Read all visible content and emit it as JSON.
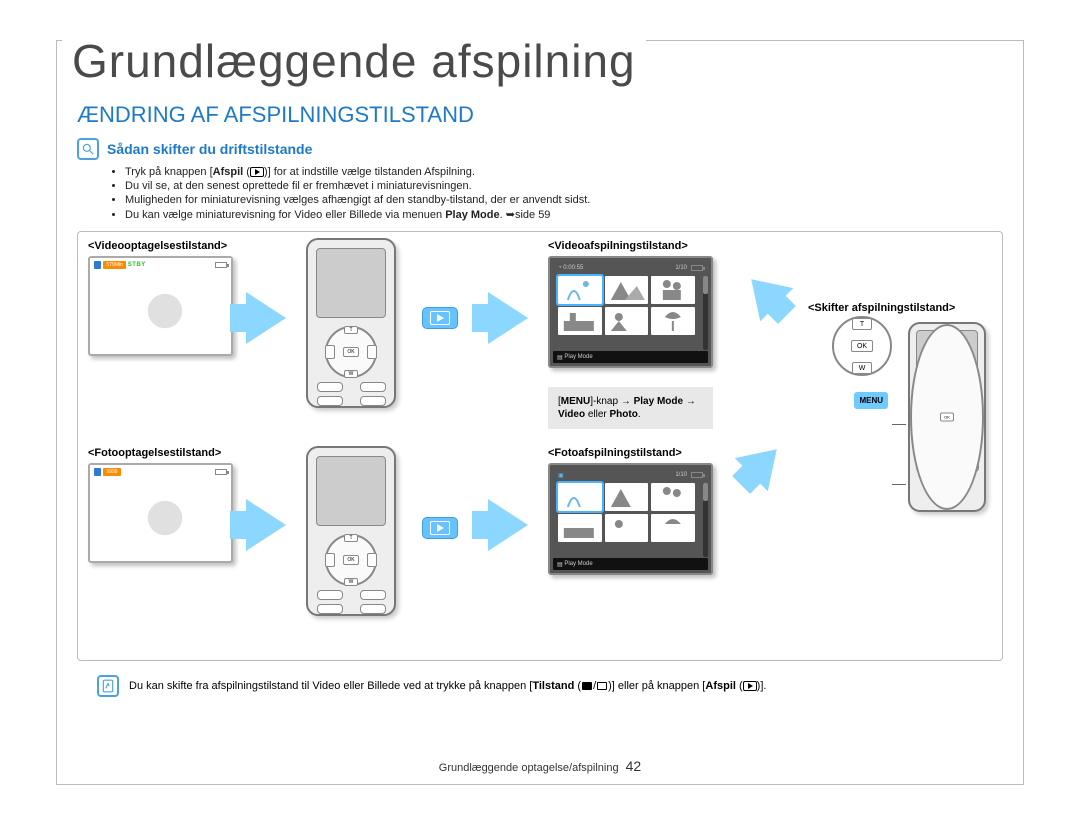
{
  "page": {
    "main_title": "Grundlæggende afspilning",
    "section_title": "ÆNDRING AF AFSPILNINGSTILSTAND",
    "subhead": "Sådan skifter du driftstilstande"
  },
  "bullets": {
    "b1_a": "Tryk på knappen [",
    "b1_bold": "Afspil",
    "b1_b": " (",
    "b1_c": ")] for at indstille vælge tilstanden Afspilning.",
    "b2": "Du vil se, at den senest oprettede fil er fremhævet i miniaturevisningen.",
    "b3": "Muligheden for miniaturevisning vælges afhængigt af den standby-tilstand, der er anvendt sidst.",
    "b4_a": "Du kan vælge miniaturevisning for Video eller Billede via menuen ",
    "b4_bold": "Play Mode",
    "b4_b": ". ",
    "b4_c": "side 59"
  },
  "diagram": {
    "video_rec_label": "<Videooptagelsestilstand>",
    "foto_rec_label": "<Fotooptagelsestilstand>",
    "video_play_label": "<Videoafspilningstilstand>",
    "foto_play_label": "<Fotoafspilningstilstand>",
    "switch_label": "<Skifter afspilningstilstand>",
    "rec_badge_time": "579Min",
    "rec_stby": "STBY",
    "foto_counter": "9999",
    "thumb_time": "0:00:55",
    "thumb_page": "1/10",
    "bottom_bar": "Play Mode",
    "menu_note_a": "[",
    "menu_note_bold1": "MENU",
    "menu_note_b": "]-knap ",
    "menu_note_bold2": "Play Mode",
    "menu_note_c": " ",
    "menu_note_bold3": "Video",
    "menu_note_d": " eller ",
    "menu_note_bold4": "Photo",
    "menu_note_e": ".",
    "dpad_t": "T",
    "dpad_w": "W",
    "dpad_ok": "OK",
    "menu_btn": "MENU"
  },
  "footnote": {
    "a": "Du kan skifte fra afspilningstilstand til Video eller Billede ved at trykke på knappen [",
    "bold1": "Tilstand",
    "b": " (",
    "c": "/",
    "d": ")] eller på knappen [",
    "bold2": "Afspil",
    "e": " (",
    "f": ")]."
  },
  "footer": {
    "text": "Grundlæggende optagelse/afspilning",
    "page": "42"
  }
}
